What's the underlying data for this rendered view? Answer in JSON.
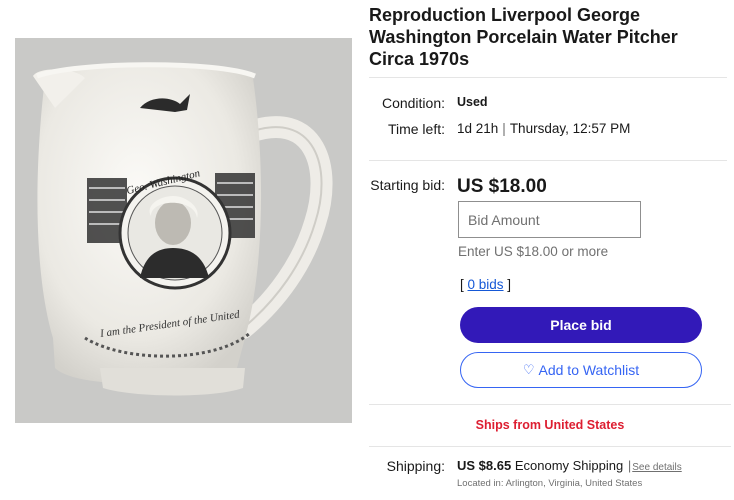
{
  "listing": {
    "title": "Reproduction Liverpool George Washington Porcelain Water Pitcher Circa 1970s",
    "image_alt": "Pitcher photo",
    "pitcher_text": {
      "banner": "Geo. Washington",
      "motto": "I am the President of the United"
    }
  },
  "details": {
    "condition_label": "Condition:",
    "condition_value": "Used",
    "time_label": "Time left:",
    "time_remaining": "1d 21h",
    "time_end": "Thursday, 12:57 PM"
  },
  "bidding": {
    "starting_label": "Starting bid:",
    "price": "US $18.00",
    "input_placeholder": "Bid Amount",
    "hint": "Enter US $18.00 or more",
    "bids_link": "0 bids",
    "place_bid_label": "Place bid",
    "watchlist_label": "Add to Watchlist"
  },
  "shipping": {
    "ships_from": "Ships from United States",
    "label": "Shipping:",
    "cost": "US $8.65",
    "method": "Economy Shipping",
    "see_details": "See details",
    "location": "Located in: Arlington, Virginia, United States"
  },
  "colors": {
    "primary_button": "#3219b8",
    "secondary_button": "#3665f3",
    "ships_red": "#dd1e31",
    "link_blue": "#1558d6"
  },
  "icons": {
    "watchlist": "heart-icon"
  }
}
